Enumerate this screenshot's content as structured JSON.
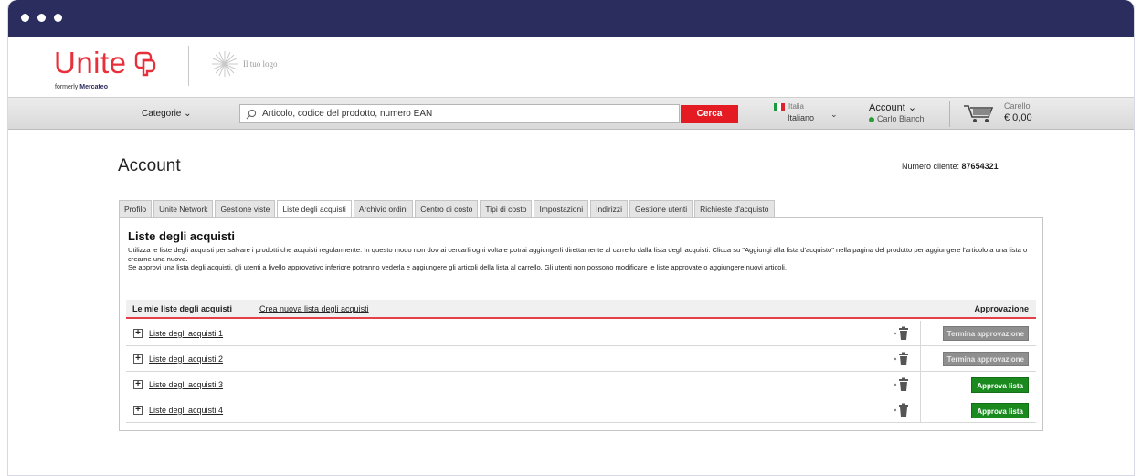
{
  "brand": {
    "name": "Unite",
    "formerly_prefix": "formerly",
    "formerly_name": "Mercateo",
    "your_logo": "Il tuo logo",
    "accent": "#e8303a",
    "titlebar": "#2b2d5e"
  },
  "toolbar": {
    "categories_label": "Categorie",
    "search_placeholder": "Articolo, codice del prodotto, numero EAN",
    "search_button": "Cerca",
    "country": "Italia",
    "language": "Italiano",
    "account_label": "Account",
    "user_name": "Carlo Bianchi",
    "cart_label": "Carello",
    "cart_total": "€ 0,00"
  },
  "page": {
    "title": "Account",
    "customer_label": "Numero cliente:",
    "customer_number": "87654321"
  },
  "tabs": [
    {
      "label": "Profilo",
      "active": false
    },
    {
      "label": "Unite Network",
      "active": false
    },
    {
      "label": "Gestione viste",
      "active": false
    },
    {
      "label": "Liste degli acquisti",
      "active": true
    },
    {
      "label": "Archivio ordini",
      "active": false
    },
    {
      "label": "Centro di costo",
      "active": false
    },
    {
      "label": "Tipi di costo",
      "active": false
    },
    {
      "label": "Impostazioni",
      "active": false
    },
    {
      "label": "Indirizzi",
      "active": false
    },
    {
      "label": "Gestione utenti",
      "active": false
    },
    {
      "label": "Richieste d'acquisto",
      "active": false
    }
  ],
  "panel": {
    "title": "Liste degli acquisti",
    "description_1": "Utilizza le liste degli acquisti per salvare i prodotti che acquisti regolarmente. In questo modo non dovrai cercarli ogni volta e potrai aggiungerli direttamente al carrello dalla lista degli acquisti. Clicca su \"Aggiungi alla lista d'acquisto\" nella pagina del prodotto per aggiungere l'articolo a una lista o crearne una nuova.",
    "description_2": "Se approvi una lista degli acquisti, gli utenti a livello approvativo inferiore potranno vederla e aggiungere gli articoli della lista al carrello. Gli utenti non possono modificare le liste approvate o aggiungere nuovi articoli.",
    "header_mine": "Le mie liste degli acquisti",
    "header_new": "Crea nuova lista degli acquisti",
    "header_approval": "Approvazione"
  },
  "lists": [
    {
      "name": "Liste degli acquisti 1",
      "action": "Termina approvazione",
      "approved": true
    },
    {
      "name": "Liste degli acquisti 2",
      "action": "Termina approvazione",
      "approved": true
    },
    {
      "name": "Liste degli acquisti 3",
      "action": "Approva lista",
      "approved": false
    },
    {
      "name": "Liste degli acquisti 4",
      "action": "Approva lista",
      "approved": false
    }
  ]
}
